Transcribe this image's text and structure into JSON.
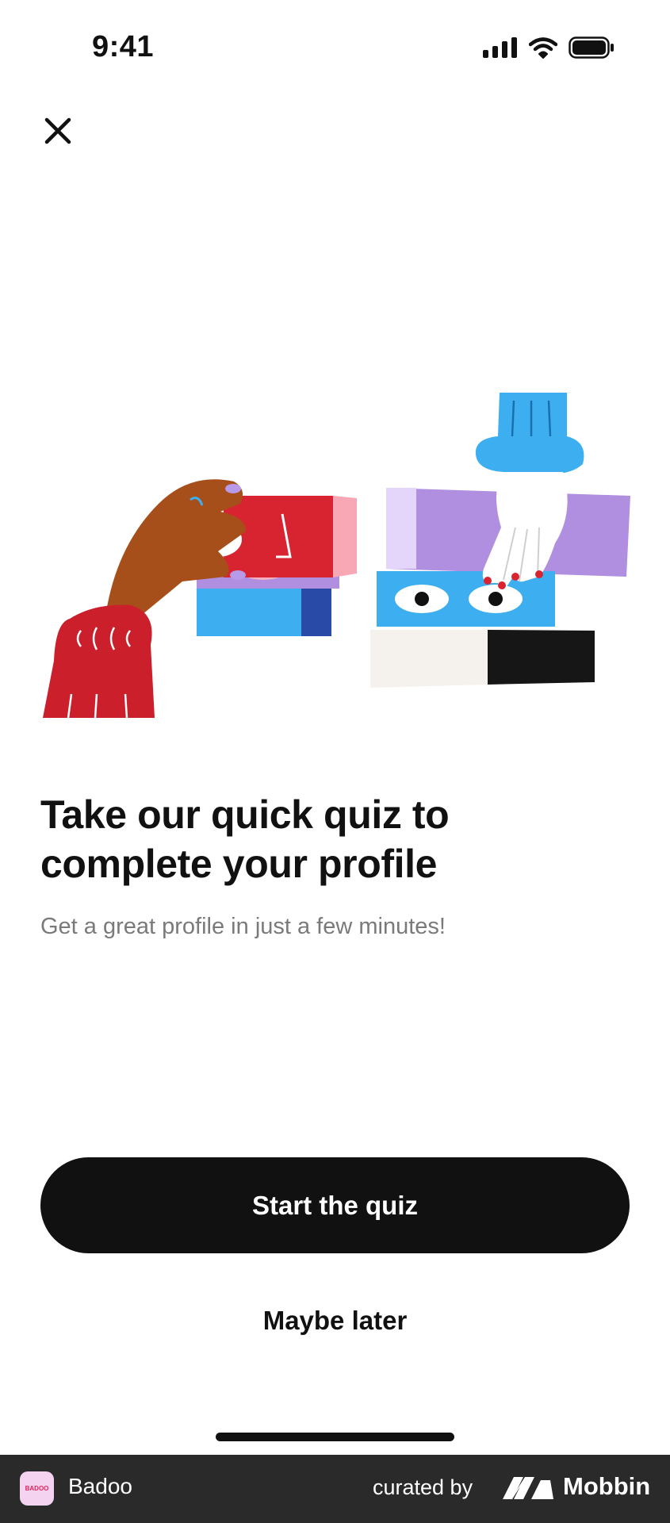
{
  "status_bar": {
    "time": "9:41"
  },
  "main": {
    "title": "Take our quick quiz to complete your profile",
    "subtitle": "Get a great profile in just a few minutes!"
  },
  "actions": {
    "primary_label": "Start the quiz",
    "secondary_label": "Maybe later"
  },
  "footer": {
    "app_icon_text": "BADOO",
    "app_name": "Badoo",
    "curated_by": "curated by",
    "brand": "Mobbin"
  },
  "icons": {
    "close": "close-icon",
    "signal": "signal-icon",
    "wifi": "wifi-icon",
    "battery": "battery-icon"
  },
  "colors": {
    "primary_button": "#111111",
    "subtitle_text": "#7a7a7a",
    "footer_background": "#2a2a2a"
  }
}
